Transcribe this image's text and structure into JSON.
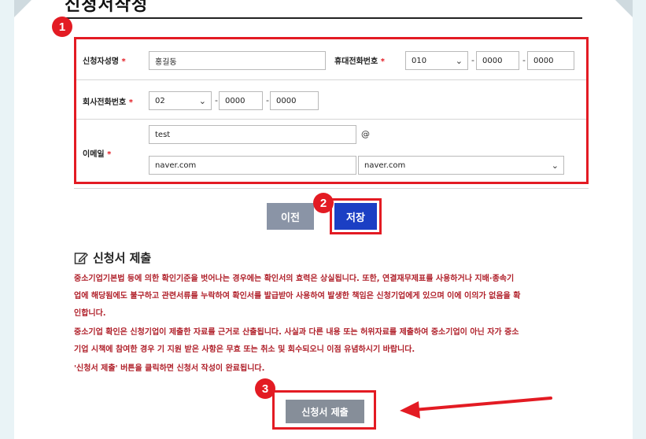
{
  "page": {
    "section_title": "신청서작성"
  },
  "badges": [
    "1",
    "2",
    "3"
  ],
  "form": {
    "applicant_name_label": "신청자성명",
    "applicant_name_value": "홍길동",
    "mobile_label": "휴대전화번호",
    "mobile_prefix": "010",
    "mobile_mid": "0000",
    "mobile_last": "0000",
    "office_phone_label": "회사전화번호",
    "office_prefix": "02",
    "office_mid": "0000",
    "office_last": "0000",
    "email_label": "이메일",
    "email_id": "test",
    "email_at": "@",
    "email_domain": "naver.com",
    "email_domain_select": "naver.com",
    "required_mark": "*"
  },
  "buttons": {
    "prev": "이전",
    "save": "저장",
    "submit": "신청서 제출"
  },
  "submit_section": {
    "heading": "신청서 제출",
    "lines": [
      "중소기업기본법 등에 의한 확인기준을 벗어나는 경우에는 확인서의 효력은 상실됩니다. 또한, 연결재무제표를 사용하거나 지배·종속기",
      "업에 해당됨에도 불구하고 관련서류를 누락하여 확인서를 발급받아 사용하여 발생한 책임은 신청기업에게 있으며 이에 이의가 없음을 확",
      "인합니다.",
      "중소기업 확인은 신청기업이 제출한 자료를 근거로 산출됩니다. 사실과 다른 내용 또는 허위자료를 제출하여 중소기업이 아닌 자가 중소",
      "기업 시책에 참여한 경우 기 지원 받은 사항은 무효 또는 취소 및 회수되오니 이점 유념하시기 바랍니다.",
      "'신청서 제출' 버튼을 클릭하면 신청서 작성이 완료됩니다."
    ]
  },
  "colors": {
    "highlight": "#e31b23",
    "save_button": "#1b3fc4",
    "notice_text": "#b0202a"
  },
  "icons": {
    "edit": "edit-icon",
    "caret": "chevron-down-icon",
    "arrow": "pointer-arrow-icon"
  }
}
